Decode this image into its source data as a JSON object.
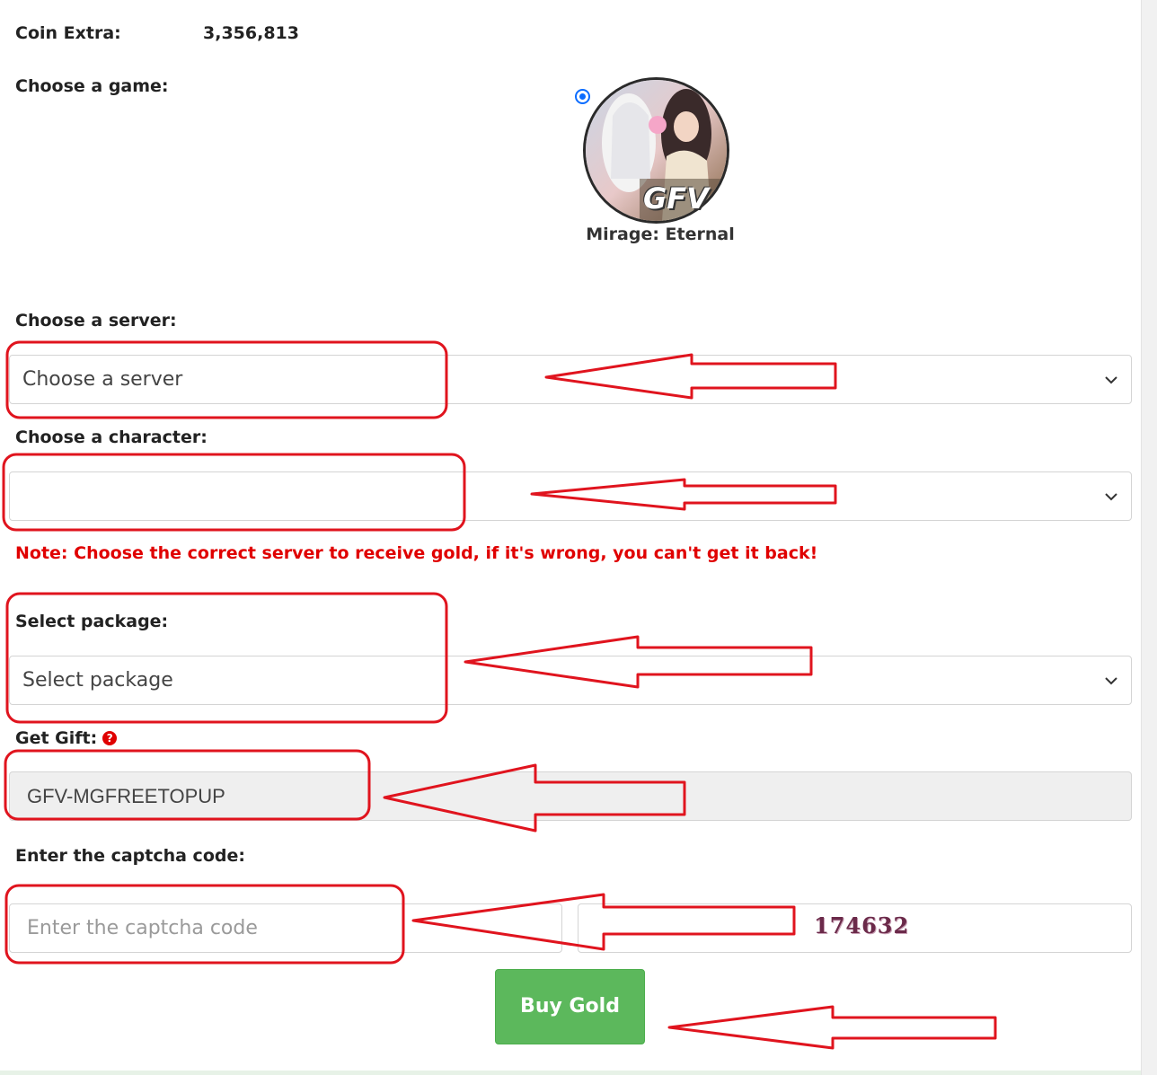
{
  "coin": {
    "label": "Coin Extra:",
    "value": "3,356,813"
  },
  "game": {
    "label": "Choose a game:",
    "options": [
      {
        "name": "Mirage: Eternal",
        "logo_text": "GFV",
        "selected": true
      }
    ]
  },
  "server": {
    "label": "Choose a server:",
    "value": "Choose a server"
  },
  "character": {
    "label": "Choose a character:",
    "value": ""
  },
  "note": "Note: Choose the correct server to receive gold, if it's wrong, you can't get it back!",
  "package": {
    "label": "Select package:",
    "value": "Select package"
  },
  "gift": {
    "label": "Get Gift:",
    "help_icon": "question-circle-icon",
    "value": "GFV-MGFREETOPUP"
  },
  "captcha": {
    "label": "Enter the captcha code:",
    "placeholder": "Enter the captcha code",
    "code": "174632"
  },
  "buy_button": "Buy Gold",
  "colors": {
    "annotation": "#e0141e",
    "button": "#5cb85c",
    "note": "#e00000"
  }
}
